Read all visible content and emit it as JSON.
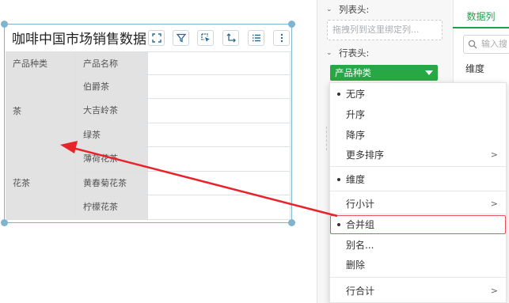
{
  "widget": {
    "title": "咖啡中国市场销售数据",
    "toolbar_icons": [
      "expand-icon",
      "filter-icon",
      "select-icon",
      "axis-icon",
      "list-icon",
      "more-icon"
    ]
  },
  "table": {
    "headers": [
      "产品种类",
      "产品名称"
    ],
    "groups": [
      {
        "category": "茶",
        "items": [
          "伯爵茶",
          "大吉岭茶",
          "绿茶"
        ]
      },
      {
        "category": "花茶",
        "items": [
          "薄荷花茶",
          "黄春菊花茶",
          "柠檬花茶"
        ]
      }
    ]
  },
  "panel": {
    "column_header_label": "列表头:",
    "column_drop_placeholder": "拖拽列到这里绑定列...",
    "row_header_label": "行表头:",
    "row_field": "产品种类",
    "data_tab": "数据列",
    "search_placeholder": "输入搜",
    "dimension_label": "维度"
  },
  "menu": {
    "items": [
      {
        "label": "无序",
        "checked": true
      },
      {
        "label": "升序"
      },
      {
        "label": "降序"
      },
      {
        "label": "更多排序",
        "submenu": true
      },
      {
        "label": "维度",
        "checked": true
      },
      {
        "label": "行小计",
        "submenu": true
      },
      {
        "label": "合并组",
        "checked": true,
        "highlighted": true
      },
      {
        "label": "别名..."
      },
      {
        "label": "删除"
      },
      {
        "label": "行合计",
        "submenu": true
      }
    ]
  },
  "colors": {
    "accent": "#27a844",
    "highlight_border": "#e8525a",
    "arrow": "#e8232a",
    "selection": "#7fb4d1"
  }
}
